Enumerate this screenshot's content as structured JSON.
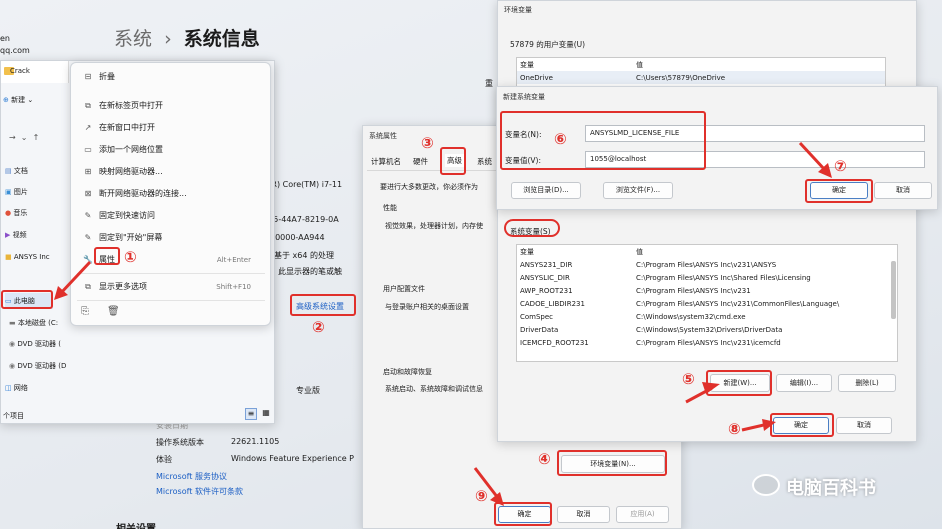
{
  "settings": {
    "breadcrumb_parent": "系统",
    "breadcrumb_sep": "›",
    "breadcrumb_current": "系统信息",
    "user_name_partial": "en",
    "user_email_partial": "qq.com",
    "rename_partial": "重",
    "cpu_partial": "tel(R) Core(TM) i7-11",
    "device_id_partial": "5855-44A7-8219-0A",
    "product_id_partial": "0-00000-AA944",
    "system_type_partial": "基于 x64 的处理",
    "pen_partial": "此显示器的笔或触",
    "link_advanced": "高级系统设置",
    "edition_partial": "专业版",
    "install_date_partial": "安装日期",
    "os_build_label": "操作系统版本",
    "os_build_value": "22621.1105",
    "experience_label": "体验",
    "experience_value": "Windows Feature Experience P",
    "link_service": "Microsoft 服务协议",
    "link_license": "Microsoft 软件许可条款",
    "related_partial": "相关设置"
  },
  "explorer": {
    "tab_title": "Crack",
    "new_label": "新建",
    "nav": [
      "文档",
      "图片",
      "音乐",
      "视频",
      "ANSYS Inc",
      "此电脑",
      "本地磁盘 (C:",
      "DVD 驱动器 (",
      "DVD 驱动器 (D",
      "网络"
    ],
    "status": "个项目"
  },
  "context_menu": {
    "items": [
      {
        "label": "折叠",
        "shortcut": "",
        "icon": "collapse-icon"
      },
      {
        "label": "在新标签页中打开",
        "shortcut": "",
        "icon": "new-tab-icon"
      },
      {
        "label": "在新窗口中打开",
        "shortcut": "",
        "icon": "new-window-icon"
      },
      {
        "label": "添加一个网络位置",
        "shortcut": "",
        "icon": "network-location-icon"
      },
      {
        "label": "映射网络驱动器...",
        "shortcut": "",
        "icon": "map-drive-icon"
      },
      {
        "label": "断开网络驱动器的连接...",
        "shortcut": "",
        "icon": "disconnect-drive-icon"
      },
      {
        "label": "固定到快速访问",
        "shortcut": "",
        "icon": "pin-icon"
      },
      {
        "label": "固定到\"开始\"屏幕",
        "shortcut": "",
        "icon": "pin-start-icon"
      },
      {
        "label": "属性",
        "shortcut": "Alt+Enter",
        "icon": "properties-icon"
      },
      {
        "label": "显示更多选项",
        "shortcut": "Shift+F10",
        "icon": "more-options-icon"
      }
    ]
  },
  "sysprops": {
    "title": "系统属性",
    "tabs": [
      "计算机名",
      "硬件",
      "高级",
      "系统"
    ],
    "intro": "要进行大多数更改，你必须作为",
    "perf_title": "性能",
    "perf_desc": "视觉效果，处理器计划，内存使",
    "profile_title": "用户配置文件",
    "profile_desc": "与登录账户相关的桌面设置",
    "startup_title": "启动和故障恢复",
    "startup_desc": "系统启动、系统故障和调试信息",
    "env_button": "环境变量(N)...",
    "ok": "确定",
    "cancel": "取消",
    "apply": "应用(A)"
  },
  "envvars": {
    "title": "环境变量",
    "user_section": "57879 的用户变量(U)",
    "col_var": "变量",
    "col_val": "值",
    "user_rows": [
      {
        "name": "OneDrive",
        "value": "C:\\Users\\57879\\OneDrive"
      }
    ],
    "system_section": "系统变量(S)",
    "system_rows": [
      {
        "name": "ANSYS231_DIR",
        "value": "C:\\Program Files\\ANSYS Inc\\v231\\ANSYS"
      },
      {
        "name": "ANSYSLIC_DIR",
        "value": "C:\\Program Files\\ANSYS Inc\\Shared Files\\Licensing"
      },
      {
        "name": "AWP_ROOT231",
        "value": "C:\\Program Files\\ANSYS Inc\\v231"
      },
      {
        "name": "CADOE_LIBDIR231",
        "value": "C:\\Program Files\\ANSYS Inc\\v231\\CommonFiles\\Language\\"
      },
      {
        "name": "ComSpec",
        "value": "C:\\Windows\\system32\\cmd.exe"
      },
      {
        "name": "DriverData",
        "value": "C:\\Windows\\System32\\Drivers\\DriverData"
      },
      {
        "name": "ICEMCFD_ROOT231",
        "value": "C:\\Program Files\\ANSYS Inc\\v231\\icemcfd"
      }
    ],
    "new_button": "新建(W)...",
    "edit_button": "编辑(I)...",
    "delete_button": "删除(L)",
    "ok": "确定",
    "cancel": "取消"
  },
  "newvar": {
    "title": "新建系统变量",
    "name_label": "变量名(N):",
    "name_value": "ANSYSLMD_LICENSE_FILE",
    "value_label": "变量值(V):",
    "value_value": "1055@localhost",
    "browse_dir": "浏览目录(D)...",
    "browse_file": "浏览文件(F)...",
    "ok": "确定",
    "cancel": "取消"
  },
  "steps": [
    "①",
    "②",
    "③",
    "④",
    "⑤",
    "⑥",
    "⑦",
    "⑧",
    "⑨"
  ],
  "watermark": "电脑百科书",
  "colors": {
    "annotation": "#e0302b",
    "link": "#1c5fc4"
  }
}
